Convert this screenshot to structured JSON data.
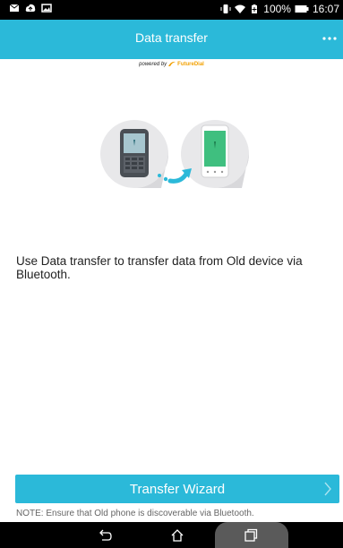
{
  "status_bar": {
    "battery": "100%",
    "time": "16:07",
    "left_icons": [
      "mail-icon",
      "cloud-upload-icon",
      "image-icon"
    ],
    "right_icons": [
      "vibrate-icon",
      "wifi-icon",
      "battery-saver-icon",
      "battery-icon"
    ]
  },
  "app_bar": {
    "title": "Data transfer",
    "more_icon": "more-horizontal-icon"
  },
  "powered_by": {
    "prefix": "powered by",
    "brand": "FutureDial"
  },
  "illustration": {
    "from_device": "old-phone-icon",
    "to_device": "new-phone-icon",
    "arrow": "transfer-arrow-icon"
  },
  "description": "Use Data transfer to transfer data from Old device via Bluetooth.",
  "wizard_button": {
    "label": "Transfer Wizard",
    "icon": "chevron-right-icon"
  },
  "note": "NOTE: Ensure that Old phone is discoverable via Bluetooth.",
  "nav_bar": {
    "buttons": [
      "back-icon",
      "home-icon",
      "recents-icon"
    ]
  },
  "colors": {
    "accent": "#2bb9d9",
    "status_bar": "#000000"
  }
}
